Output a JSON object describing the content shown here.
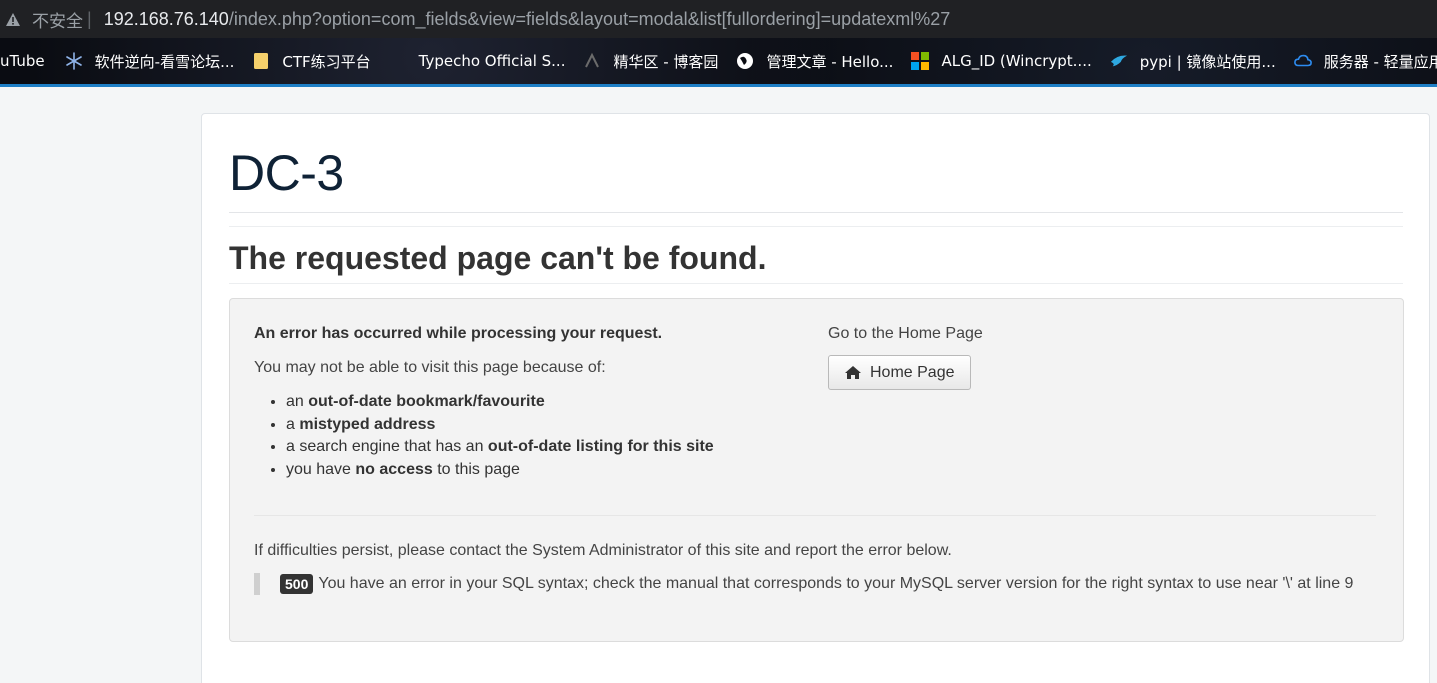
{
  "browser": {
    "security_label": "不安全",
    "separator": "|",
    "url_host": "192.168.76.140",
    "url_path": "/index.php?option=com_fields&view=fields&layout=modal&list[fullordering]=updatexml%27"
  },
  "bookmarks": [
    {
      "label": "uTube",
      "icon": "none"
    },
    {
      "label": "软件逆向-看雪论坛...",
      "icon": "snowflake-icon"
    },
    {
      "label": "CTF练习平台",
      "icon": "folder-icon"
    },
    {
      "label": "Typecho Official S...",
      "icon": "none"
    },
    {
      "label": "精华区 - 博客园",
      "icon": "cnblogs-icon"
    },
    {
      "label": "管理文章 - Hello...",
      "icon": "globe-icon"
    },
    {
      "label": "ALG_ID (Wincrypt....",
      "icon": "microsoft-icon"
    },
    {
      "label": "pypi | 镜像站使用...",
      "icon": "bird-icon"
    },
    {
      "label": "服务器 - 轻量应用",
      "icon": "cloud-icon"
    }
  ],
  "page": {
    "site_title": "DC-3",
    "heading": "The requested page can't be found.",
    "error_heading": "An error has occurred while processing your request.",
    "error_sub": "You may not be able to visit this page because of:",
    "reasons": [
      {
        "pre": "an ",
        "bold": "out-of-date bookmark/favourite",
        "post": ""
      },
      {
        "pre": "a ",
        "bold": "mistyped address",
        "post": ""
      },
      {
        "pre": "a search engine that has an ",
        "bold": "out-of-date listing for this site",
        "post": ""
      },
      {
        "pre": "you have ",
        "bold": "no access",
        "post": " to this page"
      }
    ],
    "home_label": "Go to the Home Page",
    "home_button": "Home Page",
    "persist_text": "If difficulties persist, please contact the System Administrator of this site and report the error below.",
    "error_code": "500",
    "error_message": "You have an error in your SQL syntax; check the manual that corresponds to your MySQL server version for the right syntax to use near '\\' at line 9"
  },
  "colors": {
    "accent": "#1e7fc6",
    "title": "#0f2236"
  }
}
